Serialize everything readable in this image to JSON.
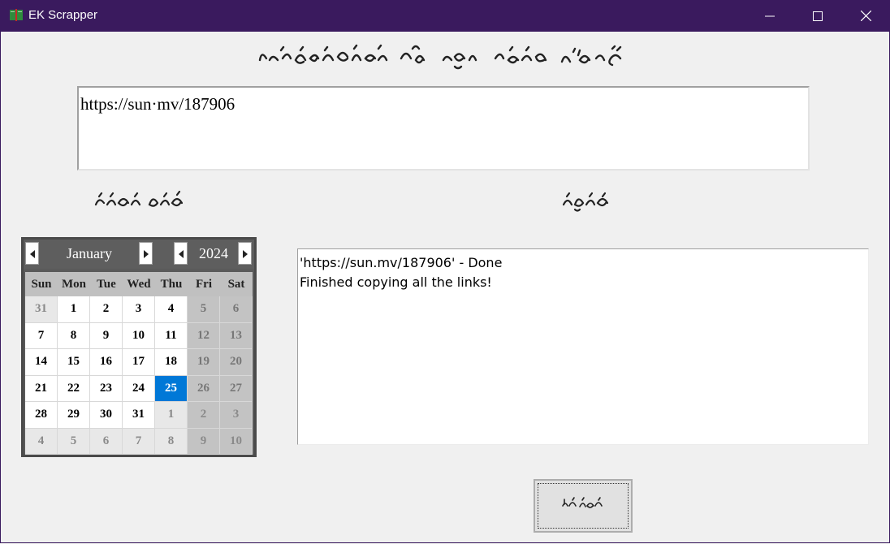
{
  "window": {
    "title": "EK Scrapper",
    "controls": [
      "minimize",
      "maximize",
      "close"
    ]
  },
  "icons": {
    "app": "book-icon",
    "minimize": "minimize-icon",
    "maximize": "maximize-icon",
    "close": "close-icon"
  },
  "url_input": {
    "value": "https://sun·mv/187906"
  },
  "calendar": {
    "month": "January",
    "year": "2024",
    "weekdays": [
      "Sun",
      "Mon",
      "Tue",
      "Wed",
      "Thu",
      "Fri",
      "Sat"
    ],
    "weeks": [
      [
        "31",
        "1",
        "2",
        "3",
        "4",
        "5",
        "6"
      ],
      [
        "7",
        "8",
        "9",
        "10",
        "11",
        "12",
        "13"
      ],
      [
        "14",
        "15",
        "16",
        "17",
        "18",
        "19",
        "20"
      ],
      [
        "21",
        "22",
        "23",
        "24",
        "25",
        "26",
        "27"
      ],
      [
        "28",
        "29",
        "30",
        "31",
        "1",
        "2",
        "3"
      ],
      [
        "4",
        "5",
        "6",
        "7",
        "8",
        "9",
        "10"
      ]
    ],
    "selected_day": "25"
  },
  "output": {
    "lines": [
      "'https://sun.mv/187906' - Done",
      "Finished copying all the links!"
    ]
  },
  "colors": {
    "titlebar": "#3a1a5e",
    "selected_day": "#0078d7",
    "window_background": "#f0f0f0"
  }
}
